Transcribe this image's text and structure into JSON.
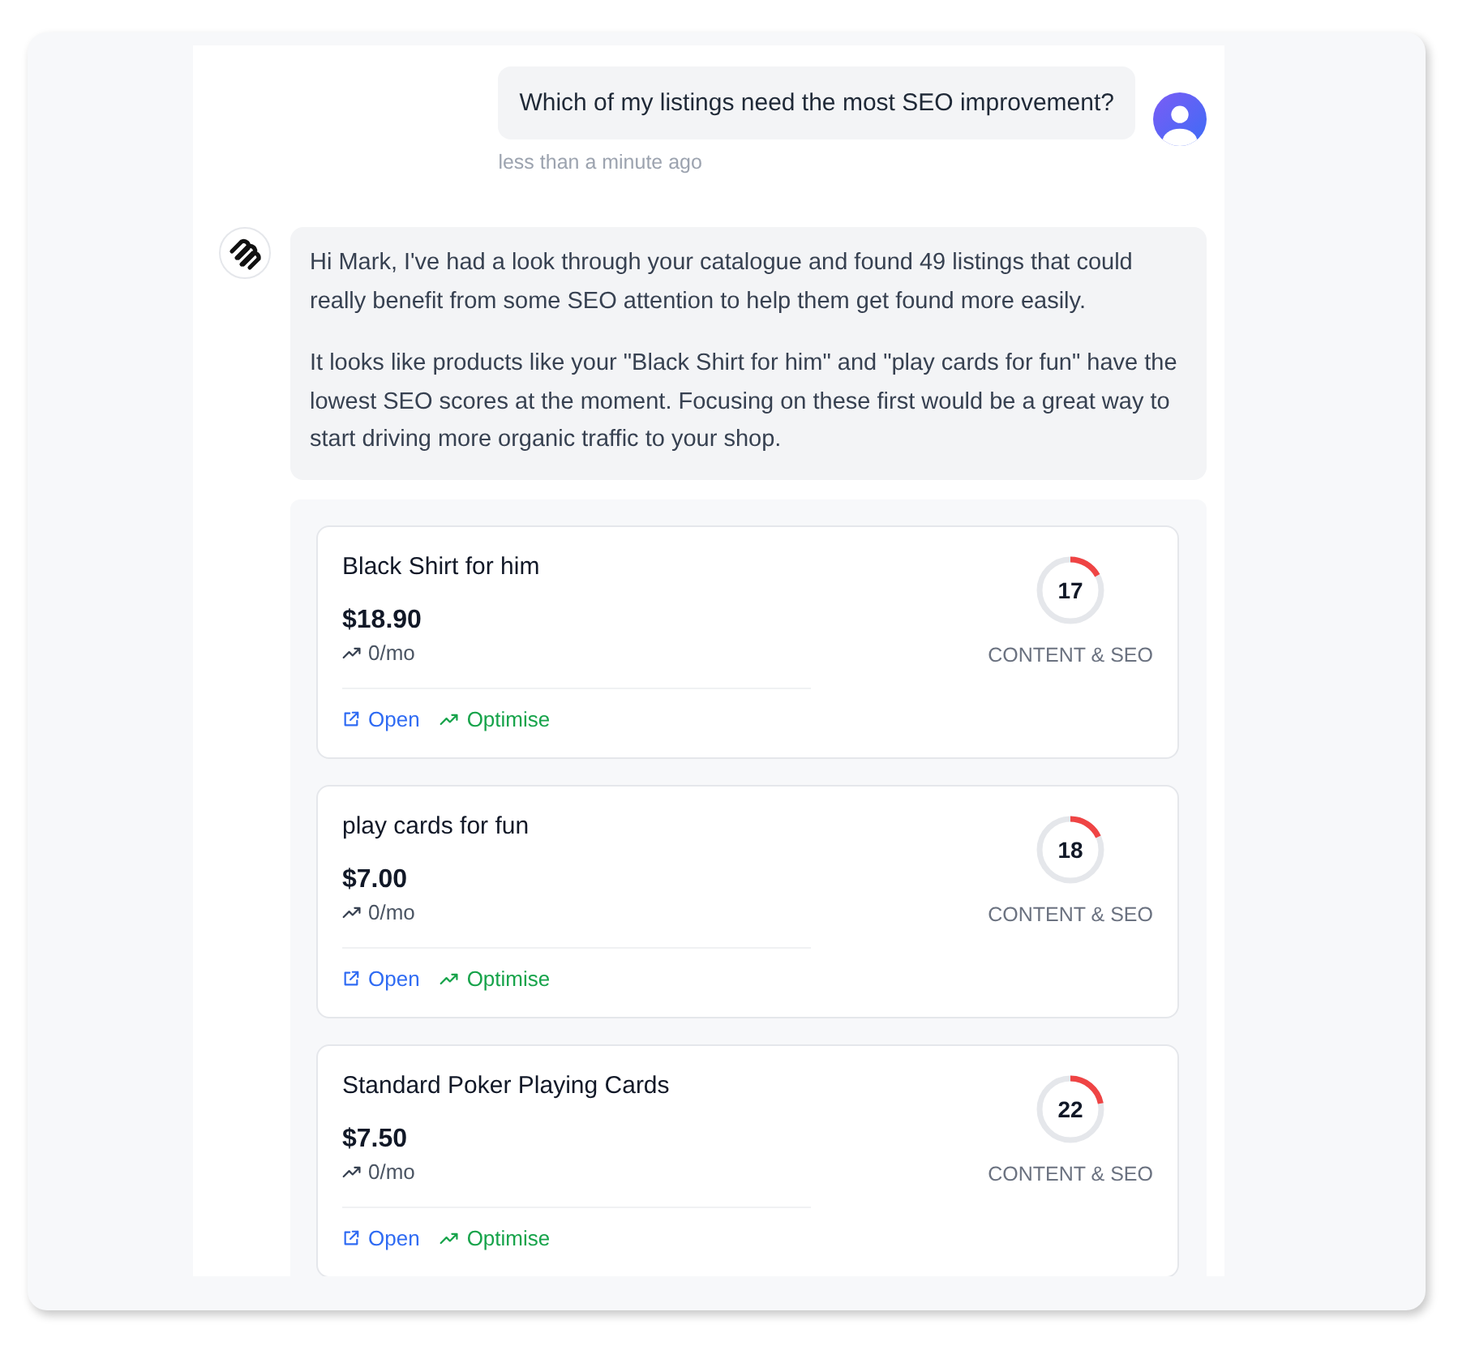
{
  "user_message": {
    "text": "Which of my listings need the most SEO improvement?",
    "time": "less than a minute ago"
  },
  "assistant_message": {
    "paragraphs": [
      "Hi Mark, I've had a look through your catalogue and found 49 listings that could really benefit from some SEO attention to help them get found more easily.",
      "It looks like products like your \"Black Shirt for him\" and \"play cards for fun\" have the lowest SEO scores at the moment. Focusing on these first would be a great way to start driving more organic traffic to your shop."
    ]
  },
  "listings": [
    {
      "title": "Black Shirt for him",
      "price": "$18.90",
      "traffic": "0/mo",
      "actions": [
        {
          "kind": "open",
          "label": "Open"
        },
        {
          "kind": "optimise",
          "label": "Optimise"
        }
      ],
      "score": "17",
      "level": 0.17,
      "score_label": "CONTENT & SEO"
    },
    {
      "title": "play cards for fun",
      "price": "$7.00",
      "traffic": "0/mo",
      "actions": [
        {
          "kind": "open",
          "label": "Open"
        },
        {
          "kind": "optimise",
          "label": "Optimise"
        }
      ],
      "score": "18",
      "level": 0.18,
      "score_label": "CONTENT & SEO"
    },
    {
      "title": "Standard Poker Playing Cards",
      "price": "$7.50",
      "traffic": "0/mo",
      "actions": [
        {
          "kind": "open",
          "label": "Open"
        },
        {
          "kind": "optimise",
          "label": "Optimise"
        }
      ],
      "score": "22",
      "level": 0.22,
      "score_label": "CONTENT & SEO"
    }
  ]
}
